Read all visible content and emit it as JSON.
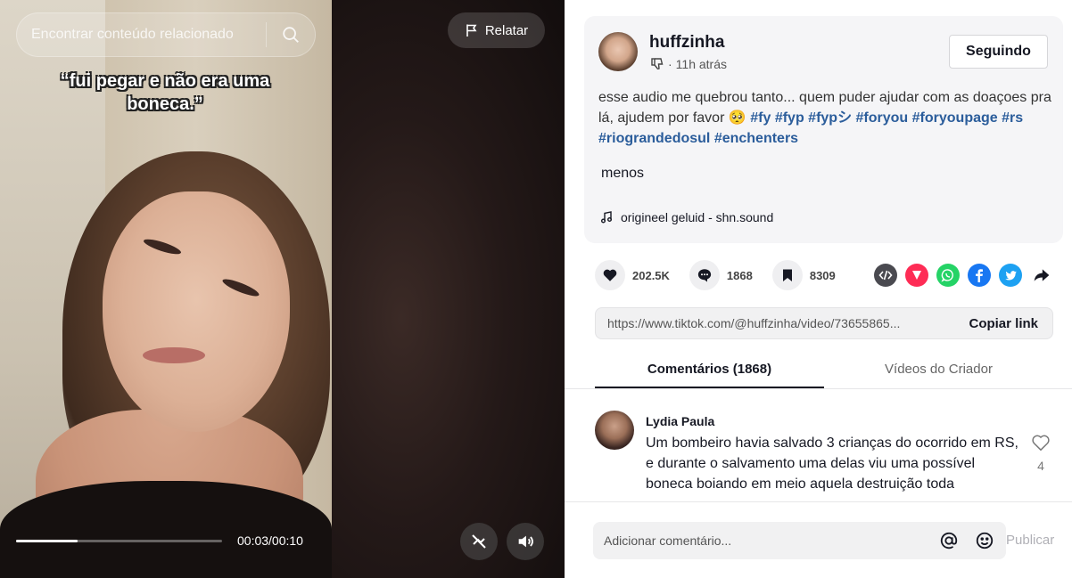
{
  "search": {
    "placeholder": "Encontrar conteúdo relacionado"
  },
  "video": {
    "caption": "“fui pegar e não era uma boneca.”",
    "report_label": "Relatar",
    "time": "00:03/00:10",
    "progress": 0.3
  },
  "post": {
    "username": "huffzinha",
    "time_ago": "11h atrás",
    "follow_label": "Seguindo",
    "description": "esse audio me quebrou tanto... quem puder ajudar com as doaçoes pra lá, ajudem por favor 🥺",
    "hashtags": [
      "#fy",
      "#fyp",
      "#fypシ",
      "#foryou",
      "#foryoupage",
      "#rs",
      "#riograndedosul",
      "#enchenters"
    ],
    "less_label": "menos",
    "sound": "origineel geluid - shn.sound"
  },
  "stats": {
    "likes": "202.5K",
    "comments": "1868",
    "saves": "8309"
  },
  "share_icons": [
    "embed-icon",
    "tiktok-send-icon",
    "whatsapp-icon",
    "facebook-icon",
    "twitter-icon",
    "share-arrow-icon"
  ],
  "link": {
    "url": "https://www.tiktok.com/@huffzinha/video/73655865...",
    "copy_label": "Copiar link"
  },
  "tabs": [
    {
      "label": "Comentários (1868)",
      "active": true
    },
    {
      "label": "Vídeos do Criador",
      "active": false
    }
  ],
  "comments": [
    {
      "user": "Lydia Paula",
      "text": "Um bombeiro havia salvado 3 crianças do ocorrido em RS, e durante o salvamento uma delas viu uma possível boneca boiando em meio aquela destruição toda",
      "likes": "4"
    }
  ],
  "composer": {
    "placeholder": "Adicionar comentário...",
    "post_label": "Publicar"
  },
  "colors": {
    "hashtag": "#2b5d9b",
    "tiktok_red": "#fe2c55",
    "whatsapp": "#25d366",
    "facebook": "#1877f2",
    "twitter": "#1da1f2"
  }
}
